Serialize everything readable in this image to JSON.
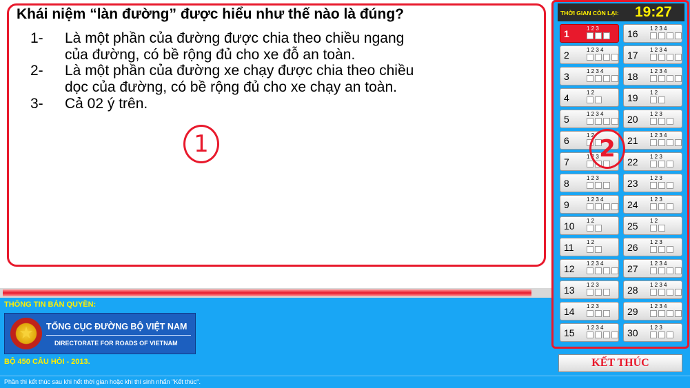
{
  "question": {
    "title": "Khái niệm “làn đường” được hiểu như thế nào là đúng?",
    "answers": [
      {
        "num": "1-",
        "lines": [
          "Là một phần của đường được chia theo chiều ngang",
          "của đường, có bề rộng đủ cho xe đỗ an toàn."
        ]
      },
      {
        "num": "2-",
        "lines": [
          "Là một phần của đường xe chạy được chia theo chiều",
          "dọc của đường, có bề rộng đủ cho xe chạy an toàn."
        ]
      },
      {
        "num": "3-",
        "lines": [
          "Cả 02 ý trên."
        ]
      }
    ],
    "annotation": "1"
  },
  "progress": {
    "fraction": 0.965
  },
  "info": {
    "title": "THÔNG TIN BẢN QUYỀN:",
    "org_name": "TỔNG CỤC ĐƯỜNG BỘ VIỆT NAM",
    "org_english": "DIRECTORATE FOR ROADS OF VIETNAM",
    "footer": "BỘ 450 CÂU HỎI - 2013."
  },
  "timer": {
    "label": "THỜI GIAN CÒN LẠI:",
    "value": "19:27"
  },
  "grid_annotation": "2",
  "questions": [
    {
      "n": "1",
      "opts": 3
    },
    {
      "n": "2",
      "opts": 4
    },
    {
      "n": "3",
      "opts": 4
    },
    {
      "n": "4",
      "opts": 2
    },
    {
      "n": "5",
      "opts": 4
    },
    {
      "n": "6",
      "opts": 2
    },
    {
      "n": "7",
      "opts": 3
    },
    {
      "n": "8",
      "opts": 3
    },
    {
      "n": "9",
      "opts": 4
    },
    {
      "n": "10",
      "opts": 2
    },
    {
      "n": "11",
      "opts": 2
    },
    {
      "n": "12",
      "opts": 4
    },
    {
      "n": "13",
      "opts": 3
    },
    {
      "n": "14",
      "opts": 3
    },
    {
      "n": "15",
      "opts": 4
    },
    {
      "n": "16",
      "opts": 4
    },
    {
      "n": "17",
      "opts": 4
    },
    {
      "n": "18",
      "opts": 4
    },
    {
      "n": "19",
      "opts": 2
    },
    {
      "n": "20",
      "opts": 3
    },
    {
      "n": "21",
      "opts": 4
    },
    {
      "n": "22",
      "opts": 3
    },
    {
      "n": "23",
      "opts": 3
    },
    {
      "n": "24",
      "opts": 3
    },
    {
      "n": "25",
      "opts": 2
    },
    {
      "n": "26",
      "opts": 3
    },
    {
      "n": "27",
      "opts": 4
    },
    {
      "n": "28",
      "opts": 4
    },
    {
      "n": "29",
      "opts": 4
    },
    {
      "n": "30",
      "opts": 3
    }
  ],
  "active_question": "1",
  "finish_label": "KẾT THÚC",
  "status_text": "Phần thi kết thúc sau khi hết thời gian hoặc khi thí sinh nhấn \"Kết thúc\".",
  "colors": {
    "accent": "#e8192c",
    "panel": "#19a6f5",
    "highlight": "#ffef00"
  }
}
